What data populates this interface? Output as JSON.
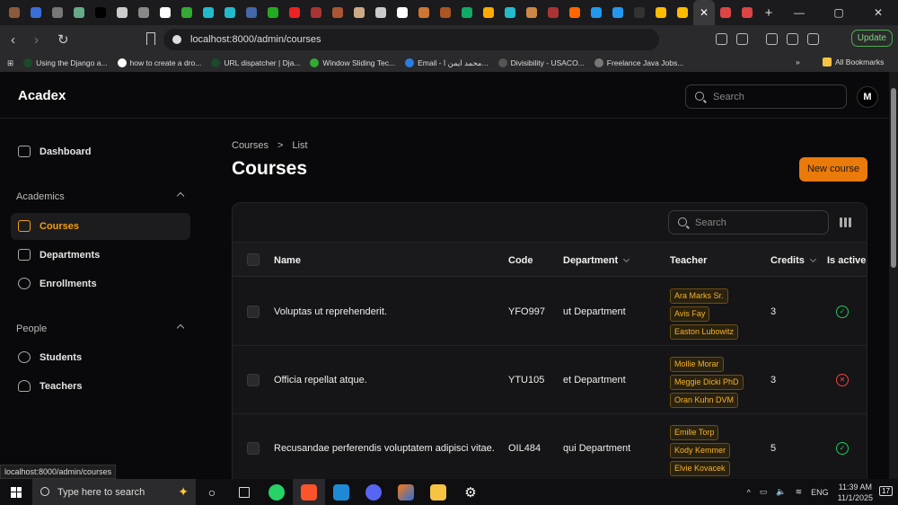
{
  "browser": {
    "url": "localhost:8000/admin/courses",
    "update_label": "Update",
    "tab_colors": [
      "#8a5a3a",
      "#3a6fd8",
      "#777",
      "#6a8",
      "#000",
      "#ccc",
      "#888",
      "#fff",
      "#3a3",
      "#2bc",
      "#2bc",
      "#46a",
      "#2a2",
      "#e22",
      "#a33",
      "#a53",
      "#ca8",
      "#ccc",
      "#fff",
      "#c73",
      "#a52",
      "#1a6",
      "#fa0",
      "#2bc",
      "#c84",
      "#a33",
      "#f60",
      "#29e",
      "#29e",
      "#333",
      "#fb0",
      "#fb0",
      "#d44",
      "#d44"
    ],
    "bookmarks": [
      "Using the Django a...",
      "how to create a dro...",
      "URL dispatcher | Dja...",
      "Window Sliding Tec...",
      "Email - محمد ايمن ا...",
      "Divisibility - USACO...",
      "Freelance Java Jobs..."
    ],
    "all_bookmarks": "All Bookmarks",
    "more": "»",
    "status_url": "localhost:8000/admin/courses"
  },
  "app": {
    "logo": "Acadex",
    "search_placeholder": "Search",
    "avatar": "M"
  },
  "sidebar": {
    "dashboard": "Dashboard",
    "groups": [
      {
        "label": "Academics",
        "items": [
          "Courses",
          "Departments",
          "Enrollments"
        ]
      },
      {
        "label": "People",
        "items": [
          "Students",
          "Teachers"
        ]
      }
    ]
  },
  "main": {
    "breadcrumb": [
      "Courses",
      "List"
    ],
    "breadcrumb_sep": ">",
    "title": "Courses",
    "new_button": "New course",
    "table_search_placeholder": "Search",
    "columns": [
      "Name",
      "Code",
      "Department",
      "Teacher",
      "Credits",
      "Is active"
    ],
    "rows": [
      {
        "name": "Voluptas ut reprehenderit.",
        "code": "YFO997",
        "department": "ut Department",
        "teachers": [
          "Ara Marks Sr.",
          "Avis Fay",
          "Easton Lubowitz"
        ],
        "credits": "3",
        "active": true
      },
      {
        "name": "Officia repellat atque.",
        "code": "YTU105",
        "department": "et Department",
        "teachers": [
          "Mollie Morar",
          "Meggie Dicki PhD",
          "Oran Kuhn DVM"
        ],
        "credits": "3",
        "active": false
      },
      {
        "name": "Recusandae perferendis voluptatem adipisci vitae.",
        "code": "OIL484",
        "department": "qui Department",
        "teachers": [
          "Emilie Torp",
          "Kody Kemmer",
          "Elvie Kovacek"
        ],
        "credits": "5",
        "active": true
      }
    ]
  },
  "taskbar": {
    "search_placeholder": "Type here to search",
    "language": "ENG",
    "time": "11:39 AM",
    "date": "11/1/2025",
    "notifications": "17"
  }
}
